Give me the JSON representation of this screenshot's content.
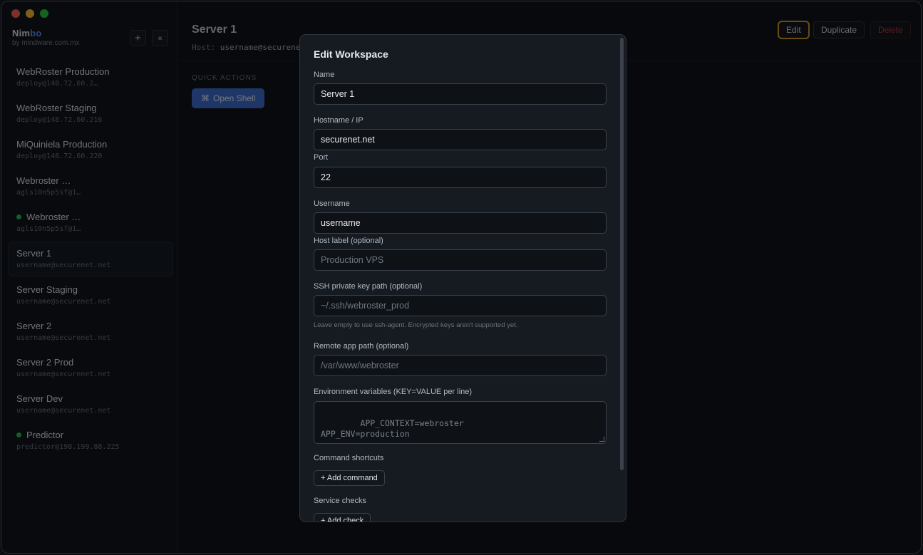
{
  "sidebar": {
    "brand_prefix": "Nim",
    "brand_accent": "bo",
    "brand_sub": "by mindware.com.mx",
    "add_button": "+",
    "collapse_button": "«",
    "servers": [
      {
        "name": "WebRoster Production",
        "host": "deploy@148.72.60.2…",
        "online": false,
        "active": false
      },
      {
        "name": "WebRoster Staging",
        "host": "deploy@148.72.60.216",
        "online": false,
        "active": false
      },
      {
        "name": "MiQuiniela Production",
        "host": "deploy@148.72.60.220",
        "online": false,
        "active": false
      },
      {
        "name": "Webroster …",
        "host": "agls10n5p5sf@1…",
        "online": false,
        "active": false
      },
      {
        "name": "Webroster …",
        "host": "agls10n5p5sf@1…",
        "online": true,
        "active": false
      },
      {
        "name": "Server 1",
        "host": "username@securenet.net",
        "online": false,
        "active": true
      },
      {
        "name": "Server Staging",
        "host": "username@securenet.net",
        "online": false,
        "active": false
      },
      {
        "name": "Server 2",
        "host": "username@securenet.net",
        "online": false,
        "active": false
      },
      {
        "name": "Server 2 Prod",
        "host": "username@securenet.net",
        "online": false,
        "active": false
      },
      {
        "name": "Server Dev",
        "host": "username@securenet.net",
        "online": false,
        "active": false
      },
      {
        "name": "Predictor",
        "host": "predictor@198.199.88.225",
        "online": true,
        "active": false
      }
    ]
  },
  "header": {
    "title": "Server 1",
    "host_label": "Host:",
    "host_value": "username@securenet.net",
    "edit_label": "Edit",
    "duplicate_label": "Duplicate",
    "delete_label": "Delete"
  },
  "quick_actions": {
    "label": "QUICK ACTIONS",
    "open_shell_icon": "⌘",
    "open_shell_label": "Open Shell"
  },
  "modal": {
    "title": "Edit Workspace",
    "name_label": "Name",
    "name_value": "Server 1",
    "hostname_label": "Hostname / IP",
    "hostname_value": "securenet.net",
    "port_label": "Port",
    "port_value": "22",
    "username_label": "Username",
    "username_value": "username",
    "host_label_label": "Host label (optional)",
    "host_label_placeholder": "Production VPS",
    "ssh_key_label": "SSH private key path (optional)",
    "ssh_key_placeholder": "~/.ssh/webroster_prod",
    "ssh_hint": "Leave empty to use ssh-agent. Encrypted keys aren't supported yet.",
    "remote_path_label": "Remote app path (optional)",
    "remote_path_placeholder": "/var/www/webroster",
    "env_label": "Environment variables (KEY=VALUE per line)",
    "env_placeholder": "APP_CONTEXT=webroster\nAPP_ENV=production",
    "command_shortcuts_label": "Command shortcuts",
    "add_command_label": "+ Add command",
    "service_checks_label": "Service checks",
    "add_check_label": "+ Add check"
  }
}
